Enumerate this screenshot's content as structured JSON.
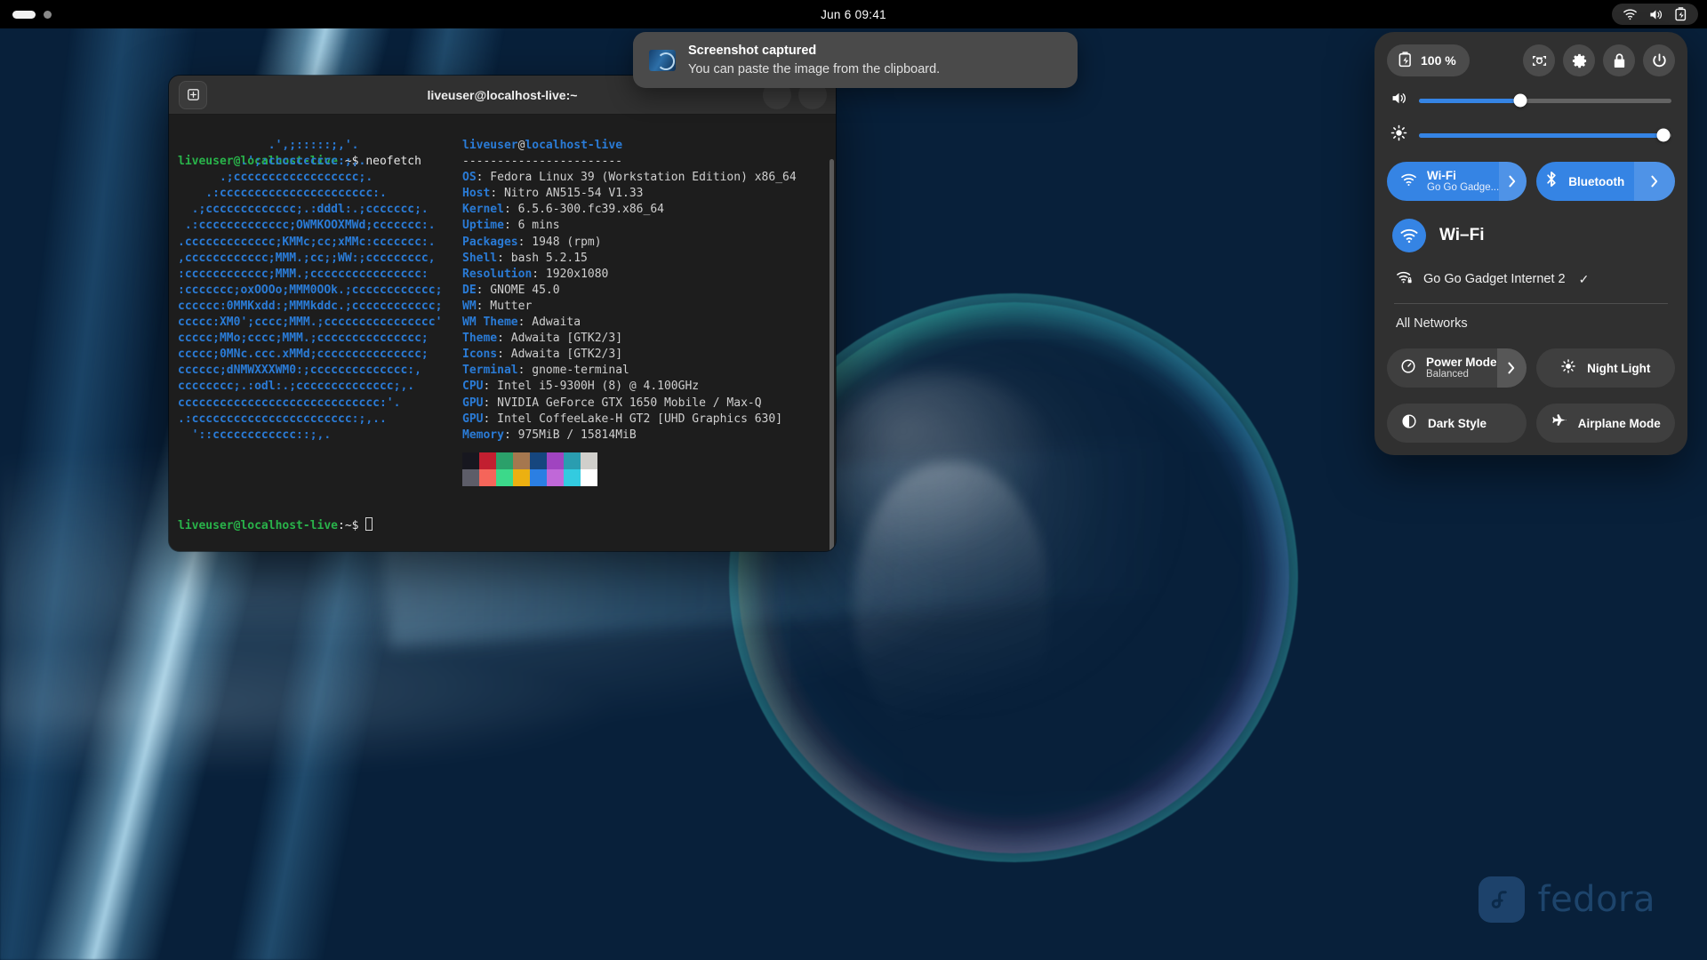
{
  "topbar": {
    "clock": "Jun 6  09:41",
    "workspaces": [
      {
        "active": true
      },
      {
        "active": false
      }
    ],
    "status_icons": [
      "wifi-icon",
      "volume-icon",
      "battery-icon"
    ]
  },
  "notification": {
    "icon": "screenshot-thumbnail-icon",
    "title": "Screenshot captured",
    "body": "You can paste the image from the clipboard."
  },
  "terminal": {
    "title": "liveuser@localhost-live:~",
    "new_tab_label": "+",
    "prompt_user": "liveuser@localhost-live",
    "prompt_path": ":~$",
    "command": "neofetch",
    "ascii": [
      "             .',;:::::;,'.",
      "         .';:cccccccccc:;,.",
      "      .;cccccccccccccccccc;.",
      "    .:cccccccccccccccccccccc:.",
      "  .;ccccccccccccc;.:dddl:.;ccccccc;.",
      " .:ccccccccccccc;OWMKOOXMWd;ccccccc:.",
      ".ccccccccccccc;KMMc;cc;xMMc:ccccccc:.",
      ",cccccccccccc;MMM.;cc;;WW:;ccccccccc,",
      ":cccccccccccc;MMM.;cccccccccccccccc:",
      ":ccccccc;oxOOOo;MMM0OOk.;cccccccccccc;",
      "cccccc:0MMKxdd:;MMMkddc.;cccccccccccc;",
      "ccccc:XM0';cccc;MMM.;cccccccccccccccc'",
      "ccccc;MMo;cccc;MMM.;ccccccccccccccc;",
      "ccccc;0MNc.ccc.xMMd;ccccccccccccccc;",
      "cccccc;dNMWXXXWM0:;cccccccccccccc:,",
      "cccccccc;.:odl:.;cccccccccccccc;,.",
      "ccccccccccccccccccccccccccccc:'.",
      ".:ccccccccccccccccccccccc:;,..",
      "  '::cccccccccccc::;,."
    ],
    "info_host": "liveuser@localhost-live",
    "info_rule": "-----------------------",
    "info": [
      {
        "key": "OS",
        "value": "Fedora Linux 39 (Workstation Edition) x86_64"
      },
      {
        "key": "Host",
        "value": "Nitro AN515-54 V1.33"
      },
      {
        "key": "Kernel",
        "value": "6.5.6-300.fc39.x86_64"
      },
      {
        "key": "Uptime",
        "value": "6 mins"
      },
      {
        "key": "Packages",
        "value": "1948 (rpm)"
      },
      {
        "key": "Shell",
        "value": "bash 5.2.15"
      },
      {
        "key": "Resolution",
        "value": "1920x1080"
      },
      {
        "key": "DE",
        "value": "GNOME 45.0"
      },
      {
        "key": "WM",
        "value": "Mutter"
      },
      {
        "key": "WM Theme",
        "value": "Adwaita"
      },
      {
        "key": "Theme",
        "value": "Adwaita [GTK2/3]"
      },
      {
        "key": "Icons",
        "value": "Adwaita [GTK2/3]"
      },
      {
        "key": "Terminal",
        "value": "gnome-terminal"
      },
      {
        "key": "CPU",
        "value": "Intel i5-9300H (8) @ 4.100GHz"
      },
      {
        "key": "GPU",
        "value": "NVIDIA GeForce GTX 1650 Mobile / Max-Q"
      },
      {
        "key": "GPU",
        "value": "Intel CoffeeLake-H GT2 [UHD Graphics 630]"
      },
      {
        "key": "Memory",
        "value": "975MiB / 15814MiB"
      }
    ],
    "palette_row1": [
      "#17171f",
      "#c21f30",
      "#2ba06a",
      "#a5774f",
      "#16467e",
      "#a044c0",
      "#2a9db0",
      "#d0cfcb"
    ],
    "palette_row2": [
      "#5d5d68",
      "#f5655a",
      "#3cd98a",
      "#ecb011",
      "#2b7fe3",
      "#c068d8",
      "#33cbe0",
      "#ffffff"
    ],
    "prompt2_user": "liveuser@localhost-live",
    "prompt2_path": ":~$"
  },
  "quicksettings": {
    "battery_percent": "100 %",
    "battery_icon": "battery-charging-icon",
    "round_buttons": [
      {
        "name": "screenshot-icon",
        "label": "Screenshot"
      },
      {
        "name": "gear-icon",
        "label": "Settings"
      },
      {
        "name": "lock-icon",
        "label": "Lock"
      },
      {
        "name": "power-icon",
        "label": "Power Off"
      }
    ],
    "volume": {
      "icon": "volume-icon",
      "value": 40
    },
    "brightness": {
      "icon": "brightness-icon",
      "value": 97
    },
    "tiles": [
      {
        "name": "wifi-tile",
        "label": "Wi-Fi",
        "sub": "Go Go Gadge...",
        "icon": "wifi-icon",
        "active": true,
        "arrow": true
      },
      {
        "name": "bluetooth-tile",
        "label": "Bluetooth",
        "sub": "",
        "icon": "bluetooth-icon",
        "active": true,
        "arrow": true
      },
      {
        "name": "power-mode-tile",
        "label": "Power Mode",
        "sub": "Balanced",
        "icon": "speedometer-icon",
        "active": false,
        "arrow": true
      },
      {
        "name": "night-light-tile",
        "label": "Night Light",
        "sub": "",
        "icon": "night-light-icon",
        "active": false,
        "arrow": false
      },
      {
        "name": "dark-style-tile",
        "label": "Dark Style",
        "sub": "",
        "icon": "dark-style-icon",
        "active": false,
        "arrow": false
      },
      {
        "name": "airplane-mode-tile",
        "label": "Airplane Mode",
        "sub": "",
        "icon": "airplane-icon",
        "active": false,
        "arrow": false
      }
    ],
    "wifi_panel": {
      "title": "Wi–Fi",
      "icon": "wifi-icon",
      "network_name": "Go Go Gadget Internet 2",
      "network_icon": "wifi-locked-icon",
      "connected_mark": "✓",
      "all_networks": "All Networks"
    }
  },
  "desktop": {
    "watermark_text": "fedora",
    "watermark_icon": "fedora-logo-icon"
  },
  "colors": {
    "accent": "#3584e4",
    "panel": "#303030",
    "tile": "#3f3f3f",
    "terminal_bg": "#1d1d1d",
    "prompt_green": "#29b34a",
    "key_blue": "#2a7bd6"
  }
}
